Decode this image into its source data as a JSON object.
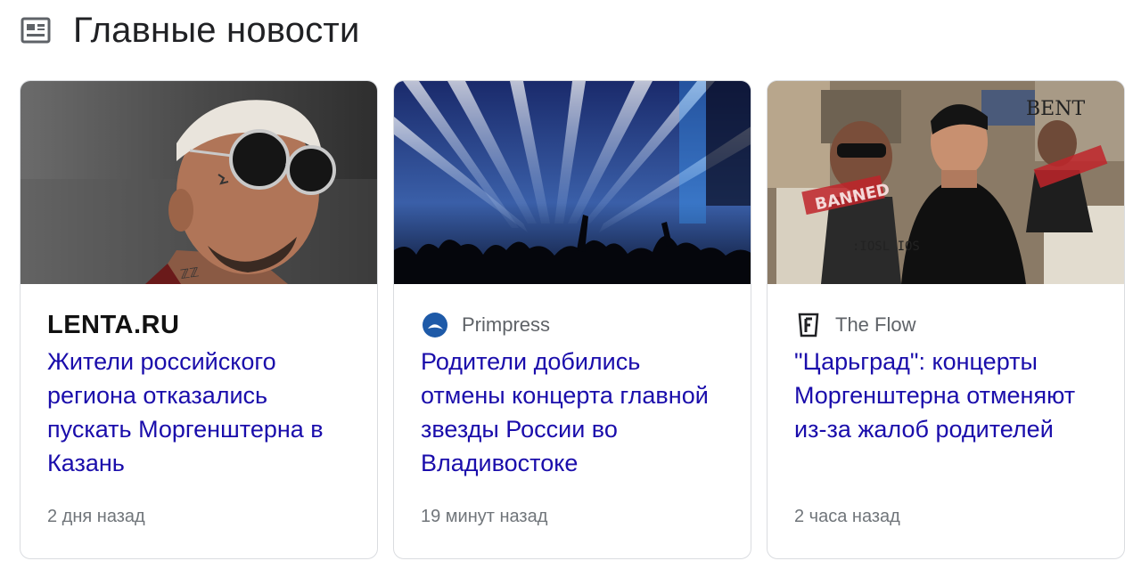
{
  "section": {
    "title": "Главные новости",
    "icon": "newspaper-icon"
  },
  "cards": [
    {
      "source": "LENTA.RU",
      "source_icon": "lenta-logo",
      "headline": "Жители российского региона отказались пускать Моргенштерна в Казань",
      "time": "2 дня назад",
      "image": "person-with-sunglasses-photo"
    },
    {
      "source": "Primpress",
      "source_icon": "primpress-logo-icon",
      "headline": "Родители добились отмены концерта главной звезды России во Владивостоке",
      "time": "19 минут назад",
      "image": "concert-lights-photo"
    },
    {
      "source": "The Flow",
      "source_icon": "the-flow-logo-icon",
      "headline": "\"Царьград\": концерты Моргенштерна отменяют из-за жалоб родителей",
      "time": "2 часа назад",
      "image": "poster-collage-photo"
    }
  ],
  "colors": {
    "headline": "#1a0dab",
    "meta": "#70757a",
    "title": "#202124",
    "border": "#dadce0"
  }
}
